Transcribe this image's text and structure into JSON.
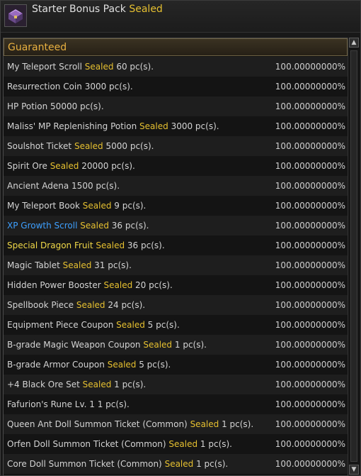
{
  "window": {
    "title": "Starter Bonus Pack",
    "title_tag": "Sealed"
  },
  "section": {
    "label": "Guaranteed"
  },
  "colors": {
    "sealed": "#e6c030",
    "blue": "#3ea0ff",
    "yellow": "#f0d848",
    "section": "#e8b040"
  },
  "items": [
    {
      "name": "My Teleport Scroll",
      "tag": "Sealed",
      "qty": "60 pc(s).",
      "pct": "100.00000000%",
      "color": "default"
    },
    {
      "name": "Resurrection Coin",
      "tag": "",
      "qty": "3000 pc(s).",
      "pct": "100.00000000%",
      "color": "default"
    },
    {
      "name": "HP Potion",
      "tag": "",
      "qty": "50000 pc(s).",
      "pct": "100.00000000%",
      "color": "default"
    },
    {
      "name": "Maliss' MP Replenishing Potion",
      "tag": "Sealed",
      "qty": "3000 pc(s).",
      "pct": "100.00000000%",
      "color": "default"
    },
    {
      "name": "Soulshot Ticket",
      "tag": "Sealed",
      "qty": "5000 pc(s).",
      "pct": "100.00000000%",
      "color": "default"
    },
    {
      "name": "Spirit Ore",
      "tag": "Sealed",
      "qty": "20000 pc(s).",
      "pct": "100.00000000%",
      "color": "default"
    },
    {
      "name": "Ancient Adena",
      "tag": "",
      "qty": "1500 pc(s).",
      "pct": "100.00000000%",
      "color": "default"
    },
    {
      "name": "My Teleport Book",
      "tag": "Sealed",
      "qty": "9 pc(s).",
      "pct": "100.00000000%",
      "color": "default"
    },
    {
      "name": "XP Growth Scroll",
      "tag": "Sealed",
      "qty": "36 pc(s).",
      "pct": "100.00000000%",
      "color": "blue"
    },
    {
      "name": "Special Dragon Fruit",
      "tag": "Sealed",
      "qty": "36 pc(s).",
      "pct": "100.00000000%",
      "color": "yellow"
    },
    {
      "name": "Magic Tablet",
      "tag": "Sealed",
      "qty": "31 pc(s).",
      "pct": "100.00000000%",
      "color": "default"
    },
    {
      "name": "Hidden Power Booster",
      "tag": "Sealed",
      "qty": "20 pc(s).",
      "pct": "100.00000000%",
      "color": "default"
    },
    {
      "name": "Spellbook Piece",
      "tag": "Sealed",
      "qty": "24 pc(s).",
      "pct": "100.00000000%",
      "color": "default"
    },
    {
      "name": "Equipment Piece Coupon",
      "tag": "Sealed",
      "qty": "5 pc(s).",
      "pct": "100.00000000%",
      "color": "default"
    },
    {
      "name": "B-grade Magic Weapon Coupon",
      "tag": "Sealed",
      "qty": "1 pc(s).",
      "pct": "100.00000000%",
      "color": "default"
    },
    {
      "name": "B-grade Armor Coupon",
      "tag": "Sealed",
      "qty": "5 pc(s).",
      "pct": "100.00000000%",
      "color": "default"
    },
    {
      "name": "+4 Black Ore Set",
      "tag": "Sealed",
      "qty": "1 pc(s).",
      "pct": "100.00000000%",
      "color": "default"
    },
    {
      "name": "Fafurion's Rune Lv. 1",
      "tag": "",
      "qty": "1 pc(s).",
      "pct": "100.00000000%",
      "color": "default"
    },
    {
      "name": "Queen Ant Doll Summon Ticket (Common)",
      "tag": "Sealed",
      "qty": "1 pc(s).",
      "pct": "100.00000000%",
      "color": "default"
    },
    {
      "name": "Orfen Doll Summon Ticket (Common)",
      "tag": "Sealed",
      "qty": "1 pc(s).",
      "pct": "100.00000000%",
      "color": "default"
    },
    {
      "name": "Core Doll Summon Ticket (Common)",
      "tag": "Sealed",
      "qty": "1 pc(s).",
      "pct": "100.00000000%",
      "color": "default"
    }
  ],
  "scrollbar": {
    "up_icon": "arrow-up-icon",
    "down_icon": "arrow-down-icon"
  }
}
